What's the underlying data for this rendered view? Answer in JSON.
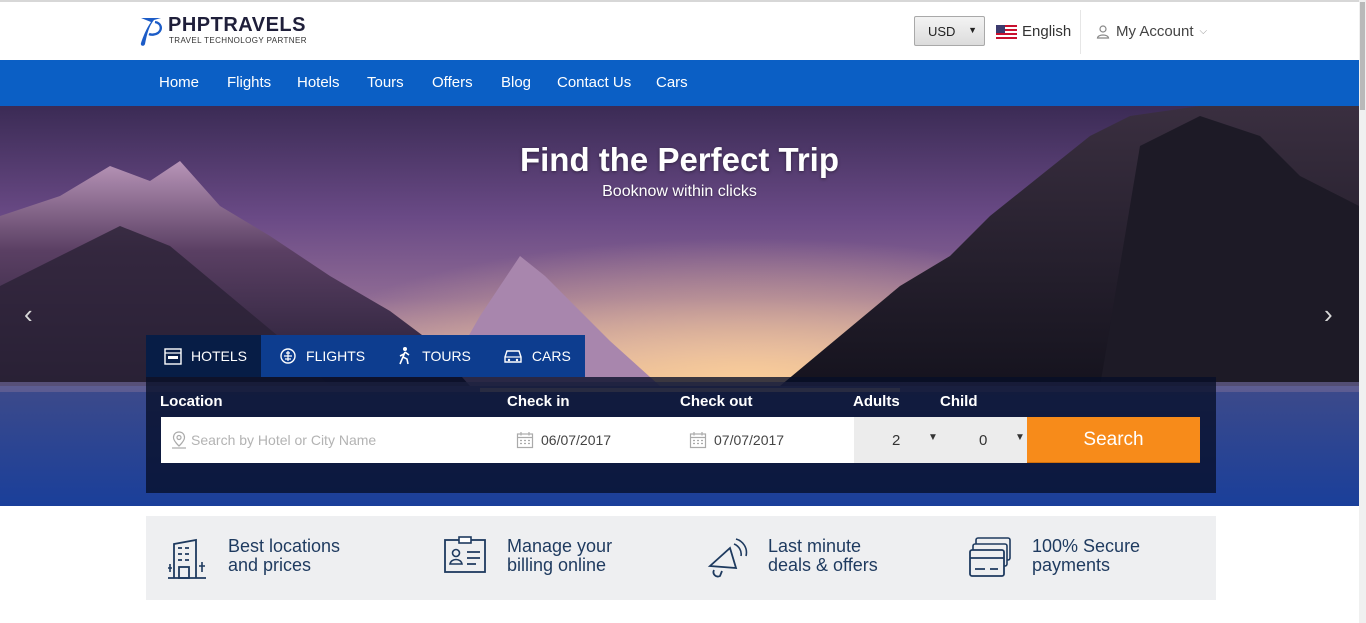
{
  "brand": {
    "name": "PHPTRAVELS",
    "tagline": "TRAVEL TECHNOLOGY PARTNER"
  },
  "header": {
    "currency": "USD",
    "language": "English",
    "account": "My Account"
  },
  "nav": [
    "Home",
    "Flights",
    "Hotels",
    "Tours",
    "Offers",
    "Blog",
    "Contact Us",
    "Cars"
  ],
  "hero": {
    "title": "Find the Perfect Trip",
    "subtitle": "Booknow within clicks"
  },
  "search": {
    "tabs": [
      "HOTELS",
      "FLIGHTS",
      "TOURS",
      "CARS"
    ],
    "active_tab": "HOTELS",
    "labels": {
      "location": "Location",
      "checkin": "Check in",
      "checkout": "Check out",
      "adults": "Adults",
      "child": "Child"
    },
    "location_placeholder": "Search by Hotel or City Name",
    "checkin_value": "06/07/2017",
    "checkout_value": "07/07/2017",
    "adults_value": "2",
    "child_value": "0",
    "button": "Search"
  },
  "features": [
    {
      "icon": "hotel-building-icon",
      "line1": "Best locations",
      "line2": "and prices"
    },
    {
      "icon": "billing-id-card-icon",
      "line1": "Manage your",
      "line2": "billing online"
    },
    {
      "icon": "megaphone-icon",
      "line1": "Last minute",
      "line2": "deals & offers"
    },
    {
      "icon": "credit-cards-icon",
      "line1": "100% Secure",
      "line2": "payments"
    }
  ],
  "colors": {
    "nav_blue": "#0b5fc5",
    "tab_blue": "#0d3d8f",
    "search_orange": "#f78b1a",
    "feature_text": "#1e3a5f"
  }
}
